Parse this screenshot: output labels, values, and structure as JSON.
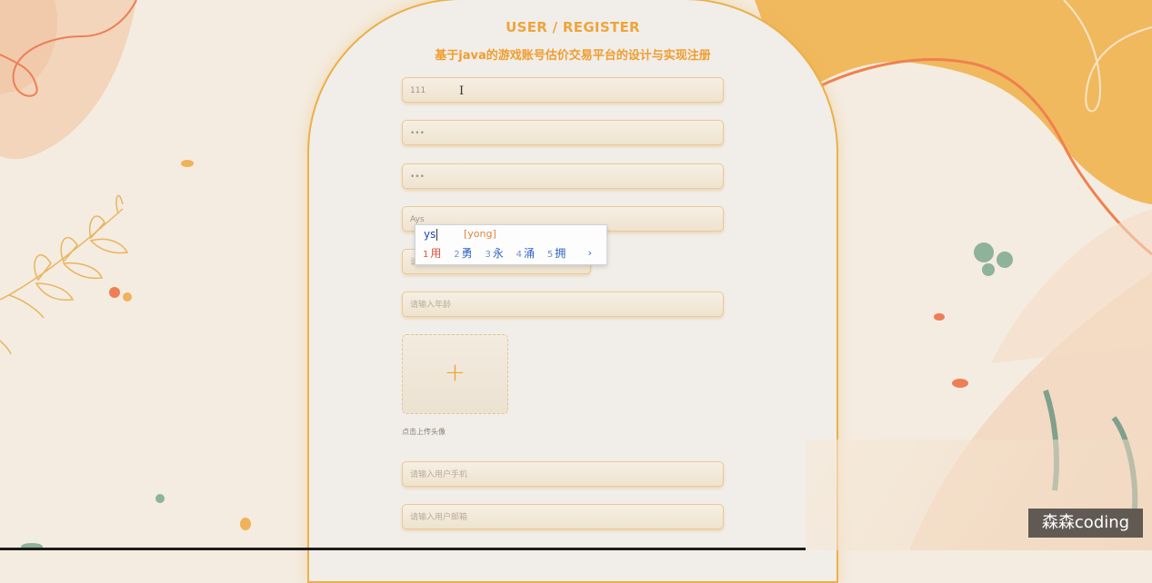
{
  "header": {
    "title": "USER / REGISTER",
    "subtitle": "基于java的游戏账号估价交易平台的设计与实现注册"
  },
  "form": {
    "account_value": "111",
    "password_value": "•••",
    "confirm_password_value": "•••",
    "name_value": "Ays",
    "gender_placeholder": "请选择性别",
    "age_placeholder": "请输入年龄",
    "upload_plus": "+",
    "upload_label": "点击上传头像",
    "phone_placeholder": "请输入用户手机",
    "email_placeholder": "请输入用户邮箱"
  },
  "ime": {
    "typed": "ys",
    "pinyin": "[yong]",
    "candidates": [
      {
        "num": "1",
        "char": "用"
      },
      {
        "num": "2",
        "char": "勇"
      },
      {
        "num": "3",
        "char": "永"
      },
      {
        "num": "4",
        "char": "涌"
      },
      {
        "num": "5",
        "char": "拥"
      }
    ],
    "next": "›"
  },
  "watermark": "森森coding",
  "colors": {
    "accent": "#efa43c",
    "card_border": "#eab04b",
    "background": "#f4ece0",
    "ime_text": "#2e62c8",
    "ime_selected": "#e0503c"
  }
}
